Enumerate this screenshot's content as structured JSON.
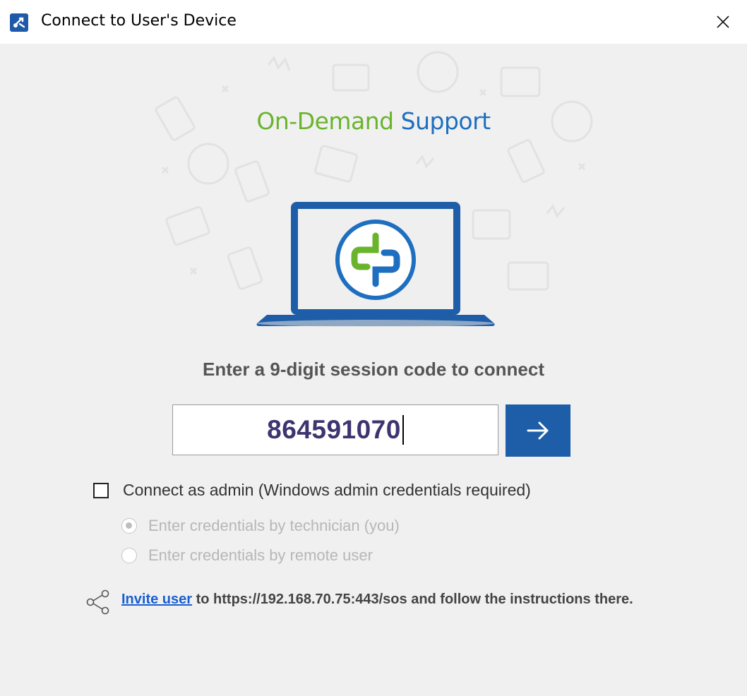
{
  "window": {
    "title": "Connect to User's Device",
    "app_icon": "remote-support-icon",
    "close_icon": "close-icon"
  },
  "hero": {
    "brand_part1": "On-Demand",
    "brand_part2": "Support",
    "brand_color_1": "#6ab42d",
    "brand_color_2": "#1e6fc0",
    "illustration": "laptop-with-support-logo"
  },
  "session": {
    "prompt": "Enter a 9-digit session code to connect",
    "code_value": "864591070",
    "submit_icon": "arrow-right-icon",
    "accent_color": "#1e5ea8"
  },
  "admin": {
    "checkbox_label": "Connect as admin (Windows admin credentials required)",
    "checked": false,
    "options": [
      {
        "label": "Enter credentials by technician (you)",
        "selected": true
      },
      {
        "label": "Enter credentials by remote user",
        "selected": false
      }
    ]
  },
  "invite": {
    "icon": "share-icon",
    "link_text": "Invite user",
    "rest_text": " to https://192.168.70.75:443/sos and follow the instructions there."
  }
}
